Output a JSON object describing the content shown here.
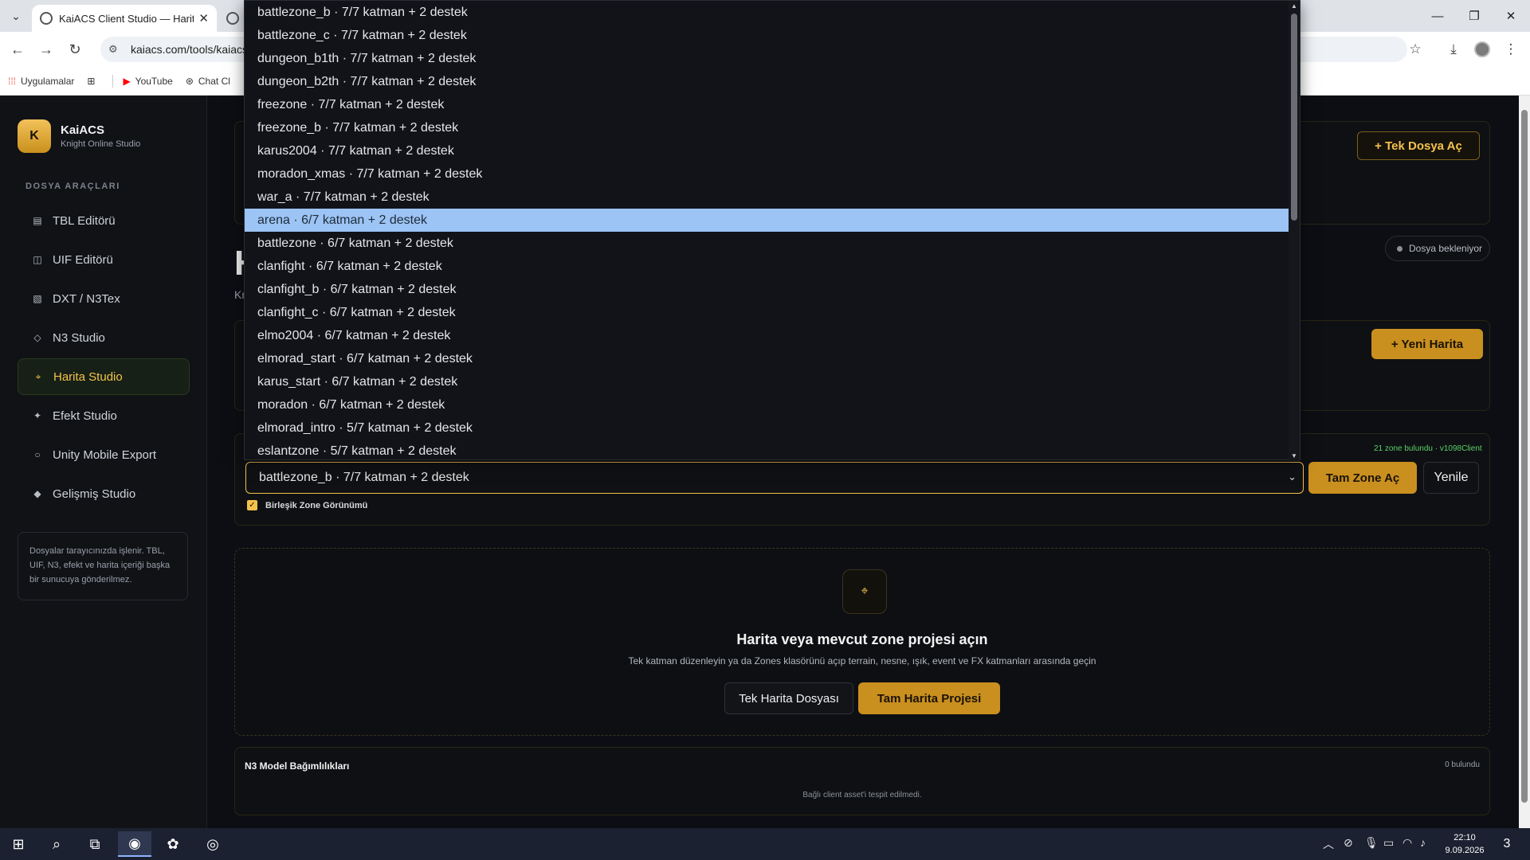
{
  "browser": {
    "tab_title": "KaiACS Client Studio — Harita S",
    "url": "kaiacs.com/tools/kaiacs-",
    "bookmarks": [
      "Uygulamalar",
      "YouTube",
      "Chat Cl"
    ]
  },
  "sidebar": {
    "brand_logo": "K",
    "brand_name": "KaiACS",
    "brand_sub": "Knight Online Studio",
    "section": "DOSYA ARAÇLARI",
    "items": [
      {
        "label": "TBL Editörü",
        "icon": "table-icon"
      },
      {
        "label": "UIF Editörü",
        "icon": "layout-icon"
      },
      {
        "label": "DXT / N3Tex",
        "icon": "texture-icon"
      },
      {
        "label": "N3 Studio",
        "icon": "diamond-icon"
      },
      {
        "label": "Harita Studio",
        "icon": "map-icon",
        "active": true
      },
      {
        "label": "Efekt Studio",
        "icon": "sparkle-icon"
      },
      {
        "label": "Unity Mobile Export",
        "icon": "circle-icon"
      },
      {
        "label": "Gelişmiş Studio",
        "icon": "diamond-filled-icon"
      }
    ],
    "note": "Dosyalar tarayıcınızda işlenir. TBL, UIF, N3, efekt ve harita içeriği başka bir sunucuya gönderilmez."
  },
  "main": {
    "open_single_file": "+ Tek Dosya Aç",
    "heading_fragment": "H",
    "sub_fragment": "Kr",
    "status": "Dosya bekleniyor",
    "new_map": "+ Yeni Harita",
    "zones_found": "21 zone bulundu · v1098Client",
    "selected_zone": "battlezone_b · 7/7 katman + 2 destek",
    "open_full_zone": "Tam Zone Aç",
    "refresh": "Yenile",
    "combined_view": "Birleşik Zone Görünümü",
    "empty_title": "Harita veya mevcut zone projesi açın",
    "empty_sub": "Tek katman düzenleyin ya da Zones klasörünü açıp terrain, nesne, ışık, event ve FX katmanları arasında geçin",
    "single_map_file": "Tek Harita Dosyası",
    "full_map_project": "Tam Harita Projesi",
    "deps_title": "N3 Model Bağımlılıkları",
    "deps_count": "0 bulundu",
    "deps_empty": "Bağlı client asset'i tespit edilmedi."
  },
  "dropdown": {
    "options": [
      "battlezone_b · 7/7 katman + 2 destek",
      "battlezone_c · 7/7 katman + 2 destek",
      "dungeon_b1th · 7/7 katman + 2 destek",
      "dungeon_b2th · 7/7 katman + 2 destek",
      "freezone · 7/7 katman + 2 destek",
      "freezone_b · 7/7 katman + 2 destek",
      "karus2004 · 7/7 katman + 2 destek",
      "moradon_xmas · 7/7 katman + 2 destek",
      "war_a · 7/7 katman + 2 destek",
      "arena · 6/7 katman + 2 destek",
      "battlezone · 6/7 katman + 2 destek",
      "clanfight · 6/7 katman + 2 destek",
      "clanfight_b · 6/7 katman + 2 destek",
      "clanfight_c · 6/7 katman + 2 destek",
      "elmo2004 · 6/7 katman + 2 destek",
      "elmorad_start · 6/7 katman + 2 destek",
      "karus_start · 6/7 katman + 2 destek",
      "moradon · 6/7 katman + 2 destek",
      "elmorad_intro · 5/7 katman + 2 destek",
      "eslantzone · 5/7 katman + 2 destek"
    ],
    "highlighted_index": 9
  },
  "taskbar": {
    "time": "22:10",
    "date": "9.09.2026",
    "notifications": "3"
  }
}
